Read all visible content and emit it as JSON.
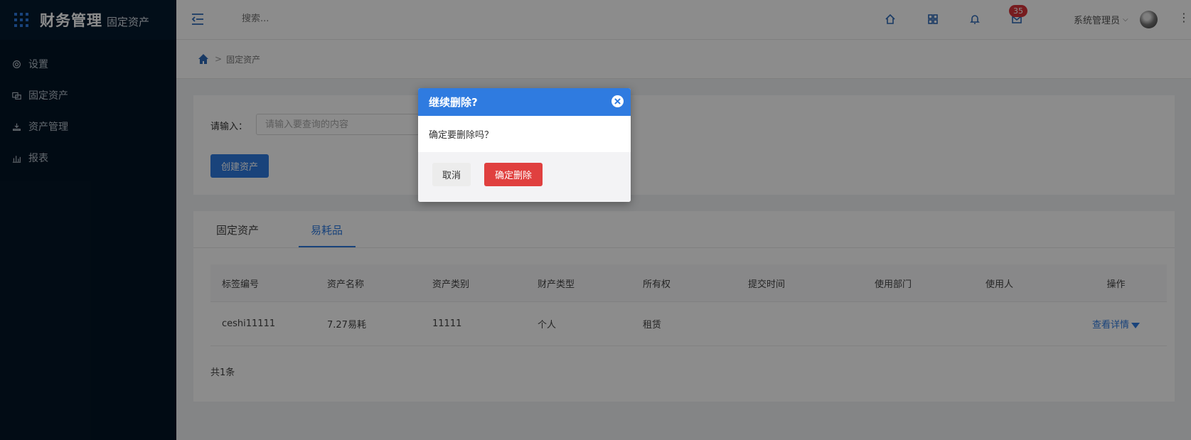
{
  "app": {
    "title": "财务管理",
    "subtitle": "固定资产"
  },
  "sidebar": {
    "items": [
      {
        "label": "设置",
        "icon": "gear-icon"
      },
      {
        "label": "固定资产",
        "icon": "assets-icon"
      },
      {
        "label": "资产管理",
        "icon": "manage-icon"
      },
      {
        "label": "报表",
        "icon": "bar-chart-icon"
      }
    ]
  },
  "header": {
    "search_placeholder": "搜索...",
    "mail_badge": "35",
    "user_name": "系统管理员"
  },
  "breadcrumb": {
    "separator": ">",
    "current": "固定资产"
  },
  "query": {
    "label": "请输入：",
    "placeholder": "请输入要查询的内容",
    "create_button": "创建资产"
  },
  "tabs": [
    {
      "label": "固定资产",
      "active": false
    },
    {
      "label": "易耗品",
      "active": true
    }
  ],
  "table": {
    "columns": [
      "标签编号",
      "资产名称",
      "资产类别",
      "财产类型",
      "所有权",
      "提交时间",
      "使用部门",
      "使用人",
      "操作"
    ],
    "rows": [
      {
        "tag": "ceshi11111",
        "name": "7.27易耗",
        "category": "11111",
        "property_type": "个人",
        "ownership": "租赁",
        "submit_time": "",
        "department": "",
        "user": "",
        "action": "查看详情"
      }
    ],
    "total": "共1条"
  },
  "modal": {
    "title": "继续删除?",
    "message": "确定要删除吗？",
    "cancel": "取消",
    "confirm": "确定删除"
  },
  "colors": {
    "primary": "#2f7be0",
    "danger": "#e0403f",
    "sidebar_bg": "#031526",
    "badge": "#d9343a"
  }
}
